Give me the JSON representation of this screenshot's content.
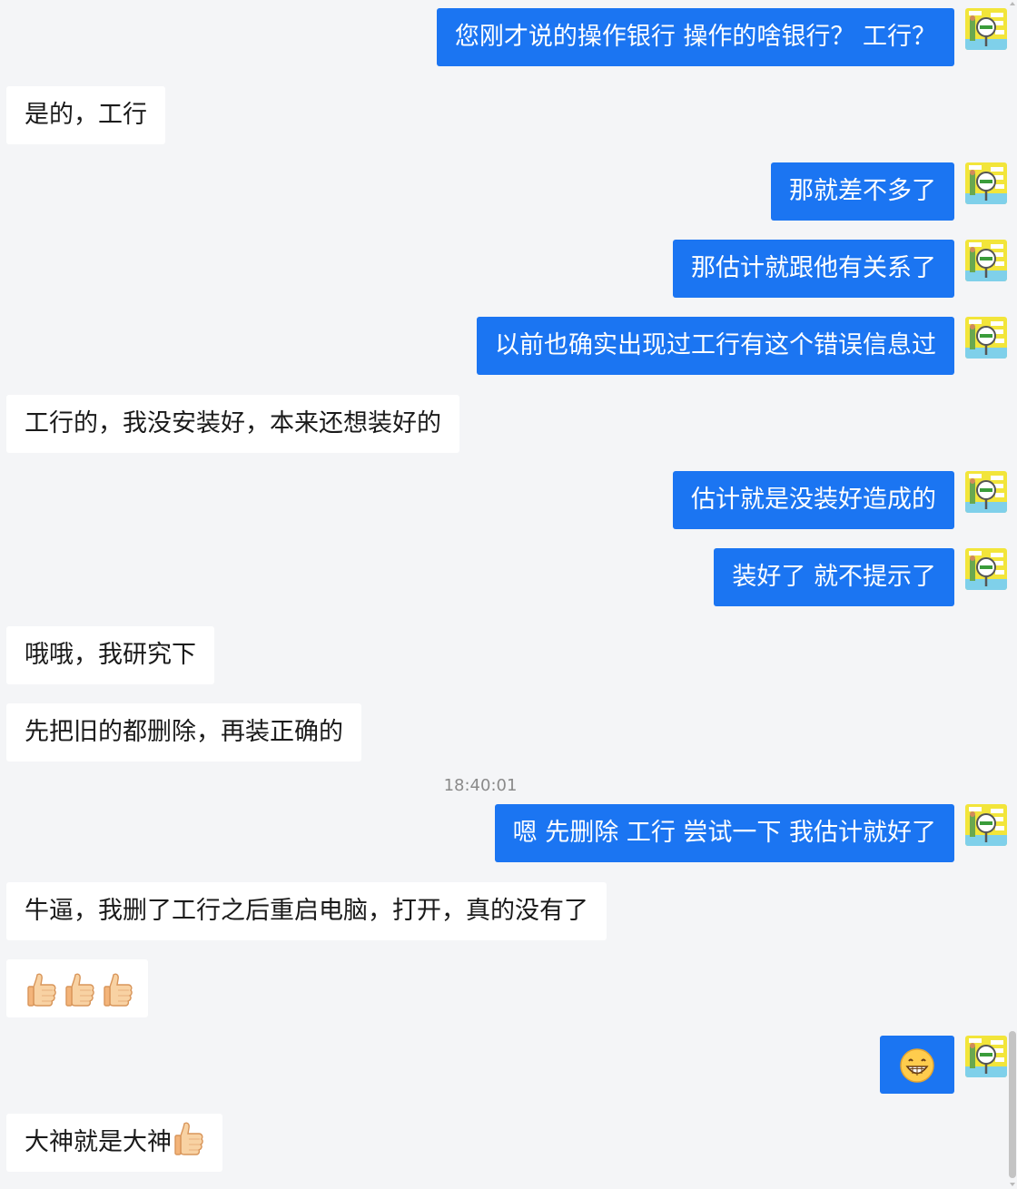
{
  "messages": [
    {
      "dir": "out",
      "text": "您刚才说的操作银行 操作的啥银行？ 工行？"
    },
    {
      "dir": "in",
      "text": "是的，工行"
    },
    {
      "dir": "out",
      "text": "那就差不多了"
    },
    {
      "dir": "out",
      "text": "那估计就跟他有关系了"
    },
    {
      "dir": "out",
      "text": "以前也确实出现过工行有这个错误信息过"
    },
    {
      "dir": "in",
      "text": "工行的，我没安装好，本来还想装好的"
    },
    {
      "dir": "out",
      "text": "估计就是没装好造成的"
    },
    {
      "dir": "out",
      "text": "装好了 就不提示了"
    },
    {
      "dir": "in",
      "text": "哦哦，我研究下"
    },
    {
      "dir": "in",
      "text": "先把旧的都删除，再装正确的"
    },
    {
      "dir": "out",
      "text": "嗯 先删除 工行 尝试一下 我估计就好了"
    },
    {
      "dir": "in",
      "text": "牛逼，我删了工行之后重启电脑，打开，真的没有了"
    },
    {
      "dir": "in",
      "emoji": [
        "thumbs-up",
        "thumbs-up",
        "thumbs-up"
      ]
    },
    {
      "dir": "out",
      "emoji": [
        "grinning-face"
      ]
    },
    {
      "dir": "in",
      "text": "大神就是大神",
      "emoji": [
        "thumbs-up"
      ]
    }
  ],
  "timestamp": "18:40:01",
  "colors": {
    "background": "#f4f5f7",
    "outgoing_bubble": "#1b75f2",
    "incoming_bubble": "#ffffff",
    "outgoing_text": "#ffffff",
    "incoming_text": "#1a1a1a"
  },
  "avatar_icon": "magnifier-cartoon-avatar"
}
